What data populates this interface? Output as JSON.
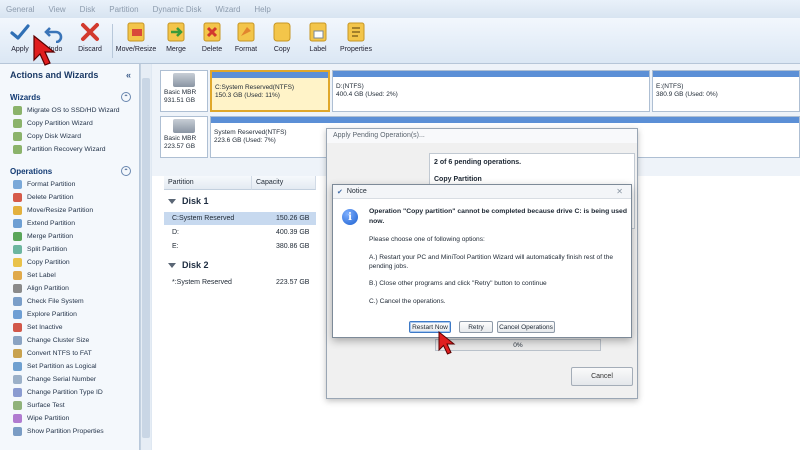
{
  "menubar": {
    "items": [
      "General",
      "View",
      "Disk",
      "Partition",
      "Dynamic Disk",
      "Wizard",
      "Help"
    ]
  },
  "toolbar": {
    "buttons": [
      {
        "label": "Apply",
        "icon": "check-icon"
      },
      {
        "label": "Undo",
        "icon": "undo-icon"
      },
      {
        "label": "Discard",
        "icon": "discard-icon"
      },
      {
        "label": "Move/Resize",
        "icon": "move-resize-icon"
      },
      {
        "label": "Merge",
        "icon": "merge-icon"
      },
      {
        "label": "Delete",
        "icon": "delete-icon"
      },
      {
        "label": "Format",
        "icon": "format-icon"
      },
      {
        "label": "Copy",
        "icon": "copy-icon"
      },
      {
        "label": "Label",
        "icon": "label-icon"
      },
      {
        "label": "Properties",
        "icon": "properties-icon"
      }
    ]
  },
  "sidebar": {
    "title": "Actions and Wizards",
    "wizards_header": "Wizards",
    "wizards": [
      "Migrate OS to SSD/HD Wizard",
      "Copy Partition Wizard",
      "Copy Disk Wizard",
      "Partition Recovery Wizard"
    ],
    "operations_header": "Operations",
    "operations": [
      "Format Partition",
      "Delete Partition",
      "Move/Resize Partition",
      "Extend Partition",
      "Merge Partition",
      "Split Partition",
      "Copy Partition",
      "Set Label",
      "Align Partition",
      "Check File System",
      "Explore Partition",
      "Set Inactive",
      "Change Cluster Size",
      "Convert NTFS to FAT",
      "Set Partition as Logical",
      "Change Serial Number",
      "Change Partition Type ID",
      "Surface Test",
      "Wipe Partition",
      "Show Partition Properties"
    ]
  },
  "disk_map": {
    "disk1": {
      "type": "Basic MBR",
      "size": "931.51 GB",
      "partitions": [
        {
          "name": "C:System Reserved(NTFS)",
          "usage": "150.3 GB (Used: 11%)"
        },
        {
          "name": "D:(NTFS)",
          "usage": "400.4 GB (Used: 2%)"
        },
        {
          "name": "E:(NTFS)",
          "usage": "380.9 GB (Used: 0%)"
        }
      ]
    },
    "disk2": {
      "type": "Basic MBR",
      "size": "223.57 GB",
      "partitions": [
        {
          "name": "System Reserved(NTFS)",
          "usage": "223.6 GB (Used: 7%)"
        }
      ]
    }
  },
  "table": {
    "headers": [
      "Partition",
      "Capacity"
    ],
    "disk1_title": "Disk 1",
    "disk1_rows": [
      {
        "partition": "C:System Reserved",
        "capacity": "150.26 GB"
      },
      {
        "partition": "D:",
        "capacity": "400.39 GB"
      },
      {
        "partition": "E:",
        "capacity": "380.86 GB"
      }
    ],
    "disk2_title": "Disk 2",
    "disk2_rows": [
      {
        "partition": "*:System Reserved",
        "capacity": "223.57 GB"
      }
    ]
  },
  "pending_dialog": {
    "title": "Apply Pending Operation(s)...",
    "count_text": "2 of 6 pending operations.",
    "op_text": "Copy Partition",
    "progress": "0%",
    "cancel": "Cancel"
  },
  "notice": {
    "title": "Notice",
    "message": "Operation \"Copy partition\" cannot be completed because drive C: is being used now.",
    "choose": "Please choose one of following options:",
    "option_a": "A.) Restart your PC and MiniTool Partition Wizard will automatically finish rest of the pending jobs.",
    "option_b": "B.) Close other programs and click \"Retry\" button to continue",
    "option_c": "C.) Cancel the operations.",
    "btn_restart": "Restart Now",
    "btn_retry": "Retry",
    "btn_cancel": "Cancel Operations"
  }
}
